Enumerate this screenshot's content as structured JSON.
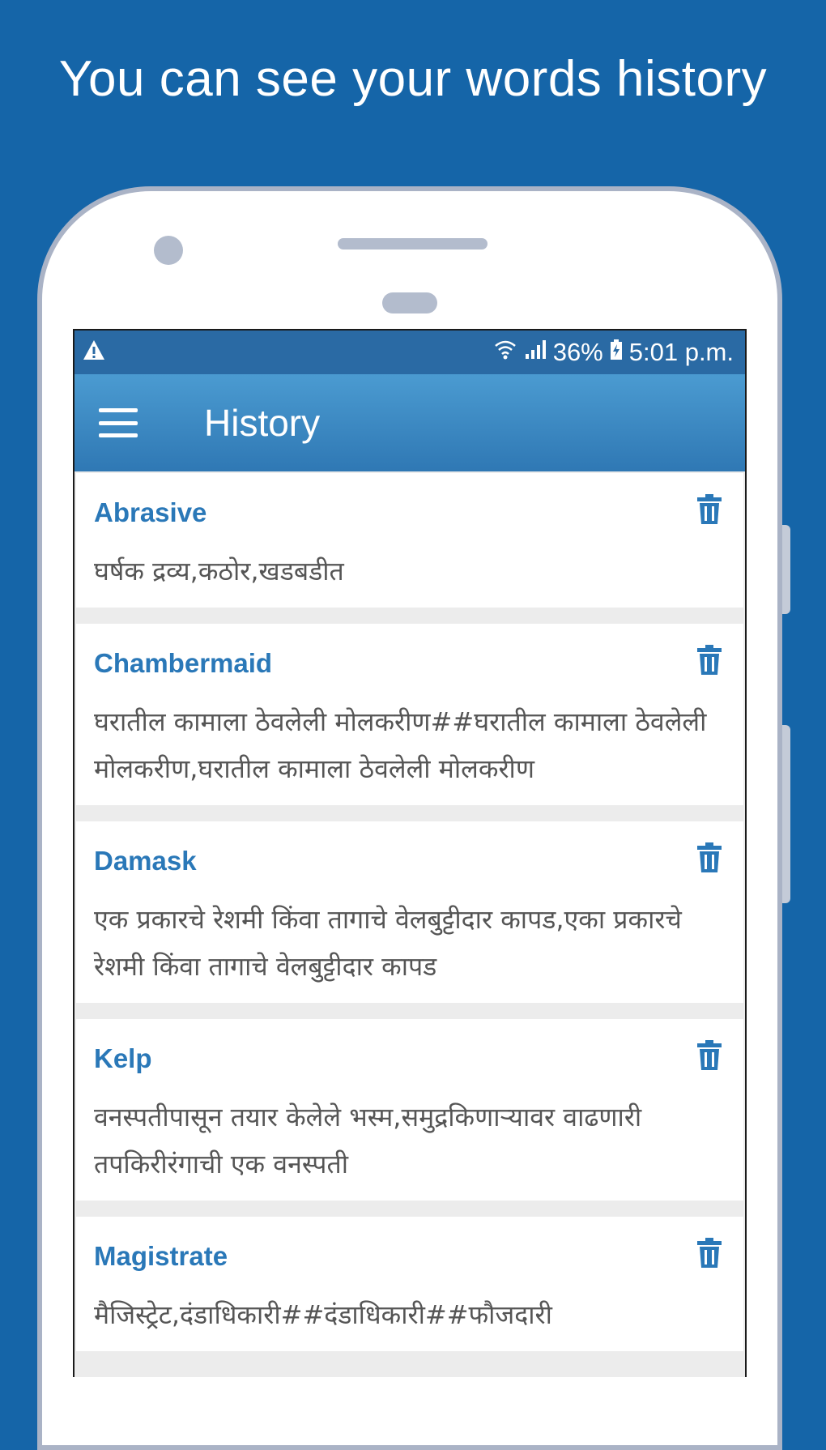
{
  "promo": {
    "title": "You can see your words history"
  },
  "status_bar": {
    "battery": "36%",
    "time": "5:01 p.m."
  },
  "app_bar": {
    "title": "History"
  },
  "history": [
    {
      "word": "Abrasive",
      "meaning": "घर्षक द्रव्य,कठोर,खडबडीत"
    },
    {
      "word": "Chambermaid",
      "meaning": "घरातील कामाला ठेवलेली मोलकरीण##घरातील कामाला ठेवलेली मोलकरीण,घरातील कामाला ठेवलेली मोलकरीण"
    },
    {
      "word": "Damask",
      "meaning": "एक प्रकारचे रेशमी किंवा तागाचे वेलबुट्टीदार कापड,एका प्रकारचे रेशमी किंवा तागाचे वेलबुट्टीदार कापड"
    },
    {
      "word": "Kelp",
      "meaning": "वनस्पतीपासून तयार केलेले भस्म,समुद्रकिणाऱ्यावर वाढणारी तपकिरीरंगाची एक वनस्पती"
    },
    {
      "word": "Magistrate",
      "meaning": "मैजिस्ट्रेट,दंडाधिकारी##दंडाधिकारी##फौजदारी"
    }
  ],
  "icons": {
    "warning": "warning-icon",
    "wifi": "wifi-icon",
    "signal": "signal-icon",
    "battery": "battery-icon",
    "menu": "menu-icon",
    "delete": "trash-icon"
  },
  "colors": {
    "background": "#1565a8",
    "app_bar": "#3a86c2",
    "status_bar": "#2a6aa4",
    "word": "#2a78b8"
  }
}
